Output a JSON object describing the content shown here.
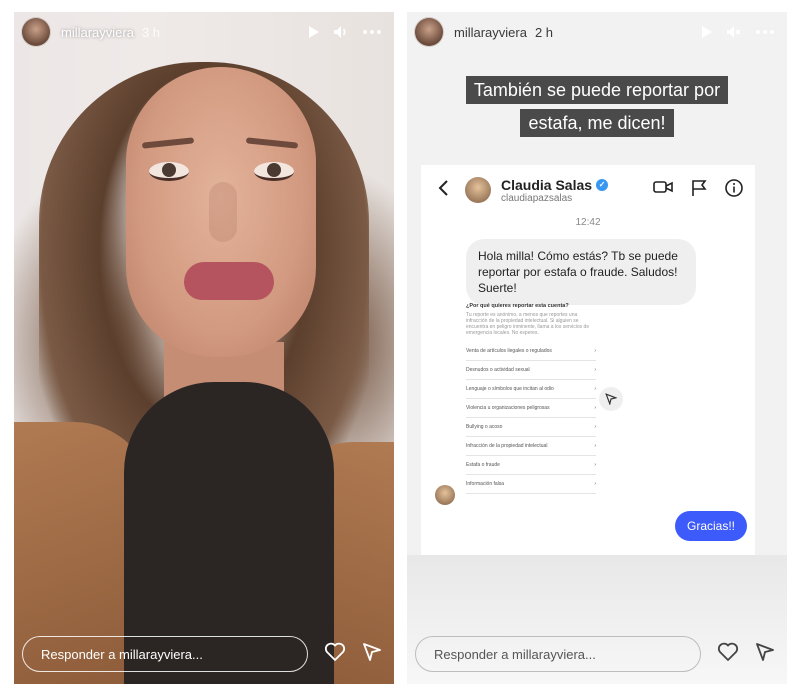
{
  "stories": {
    "left": {
      "username": "millarayviera",
      "time": "3 h",
      "reply_placeholder": "Responder a millarayviera..."
    },
    "right": {
      "username": "millarayviera",
      "time": "2 h",
      "reply_placeholder": "Responder a millarayviera...",
      "caption": "También se puede reportar por estafa, me dicen!",
      "dm": {
        "name": "Claudia Salas",
        "handle": "claudiapazsalas",
        "timestamp": "12:42",
        "incoming_message": "Hola milla! Cómo estás? Tb se puede reportar por estafa o fraude. Saludos! Suerte!",
        "outgoing_message": "Gracias!!",
        "report_screenshot": {
          "title": "¿Por qué quieres reportar esta cuenta?",
          "subtitle": "Tu reporte es anónimo, a menos que reportes una infracción de la propiedad intelectual. Si alguien se encuentra en peligro inminente, llama a los servicios de emergencia locales. No esperes.",
          "options": [
            "Venta de artículos ilegales o regulados",
            "Desnudos o actividad sexual",
            "Lenguaje o símbolos que incitan al odio",
            "Violencia u organizaciones peligrosas",
            "Bullying o acoso",
            "Infracción de la propiedad intelectual",
            "Estafa o fraude",
            "Información falsa"
          ]
        }
      }
    }
  },
  "icons": {
    "play": "play-icon",
    "volume": "volume-icon",
    "muted": "muted-icon",
    "more": "more-icon",
    "heart": "heart-icon",
    "send": "send-icon"
  },
  "colors": {
    "caption_bg": "#4a4a4a",
    "outgoing_bubble": "#3d5bfb",
    "verified": "#3897f0"
  }
}
